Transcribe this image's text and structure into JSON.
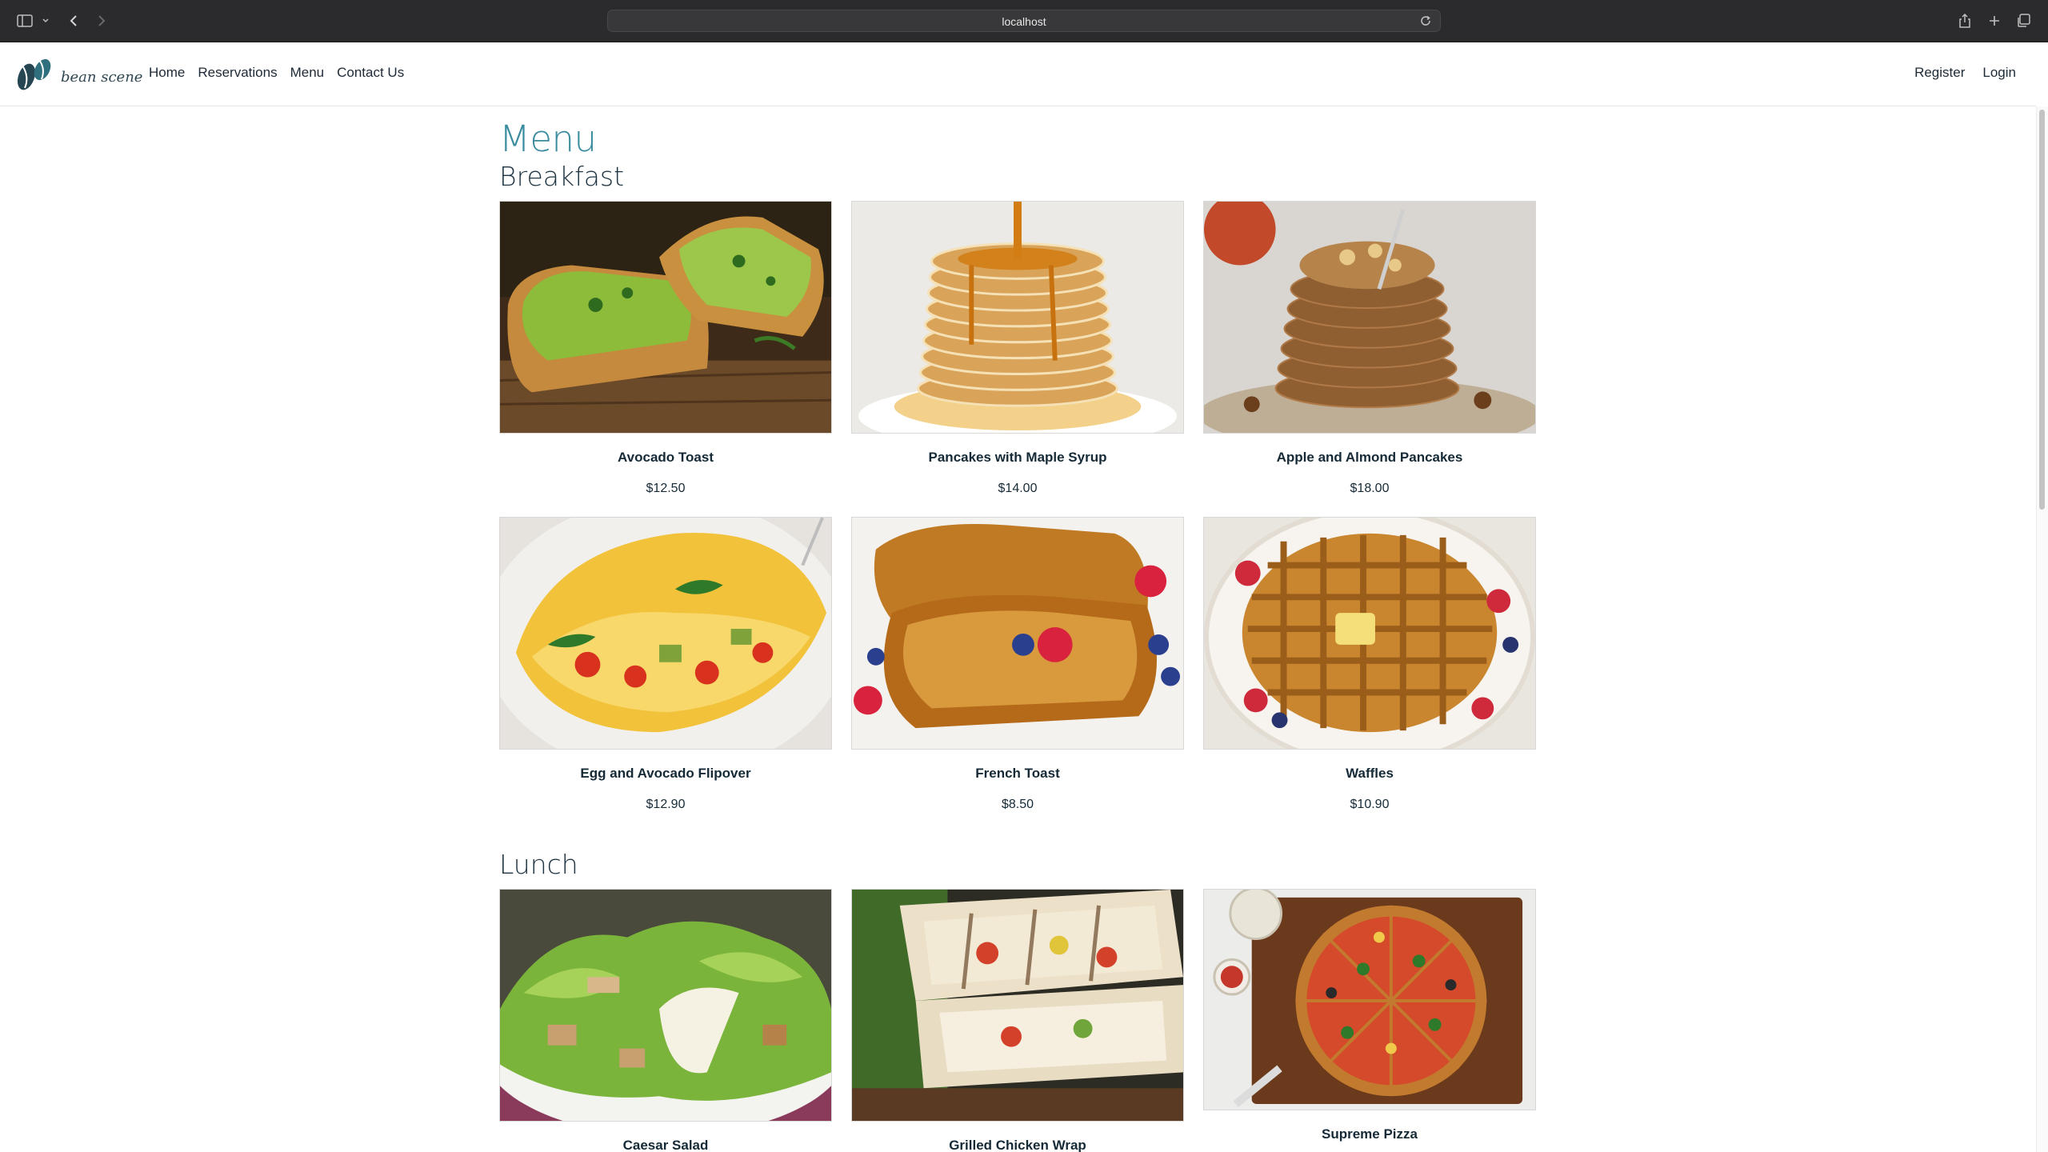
{
  "browser": {
    "url": "localhost"
  },
  "site": {
    "brand_name": "bean scene",
    "nav_left": [
      "Home",
      "Reservations",
      "Menu",
      "Contact Us"
    ],
    "nav_right": [
      "Register",
      "Login"
    ]
  },
  "page": {
    "title": "Menu"
  },
  "sections": [
    {
      "title": "Breakfast",
      "items": [
        {
          "name": "Avocado Toast",
          "price": "$12.50"
        },
        {
          "name": "Pancakes with Maple Syrup",
          "price": "$14.00"
        },
        {
          "name": "Apple and Almond Pancakes",
          "price": "$18.00"
        },
        {
          "name": "Egg and Avocado Flipover",
          "price": "$12.90"
        },
        {
          "name": "French Toast",
          "price": "$8.50"
        },
        {
          "name": "Waffles",
          "price": "$10.90"
        }
      ]
    },
    {
      "title": "Lunch",
      "items": [
        {
          "name": "Caesar Salad",
          "price": ""
        },
        {
          "name": "Grilled Chicken Wrap",
          "price": ""
        },
        {
          "name": "Supreme Pizza",
          "price": ""
        }
      ]
    }
  ],
  "colors": {
    "accent": "#3a8ba0",
    "heading": "#1e3442",
    "chrome": "#2b2b2d"
  }
}
